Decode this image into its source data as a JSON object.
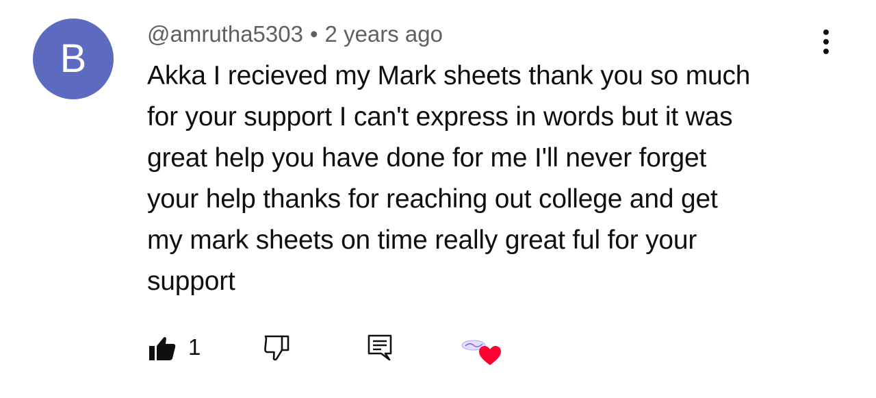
{
  "comment": {
    "avatar_letter": "B",
    "avatar_color": "#5c6bc0",
    "author": "@amrutha5303",
    "separator": "•",
    "timestamp": "2 years ago",
    "text": "Akka I recieved my Mark sheets thank you so much\nfor your support I can't express in words but it was\ngreat help you have done for me I'll never forget\nyour help thanks for reaching out college and get\nmy mark sheets on time really great ful for your\nsupport",
    "like_count": "1",
    "icons": {
      "more": "more-vert-icon",
      "like": "thumb-up-filled-icon",
      "dislike": "thumb-down-outline-icon",
      "reply": "comment-reply-icon",
      "creator_heart": "creator-heart-icon"
    },
    "heart_color": "#ff0033"
  }
}
